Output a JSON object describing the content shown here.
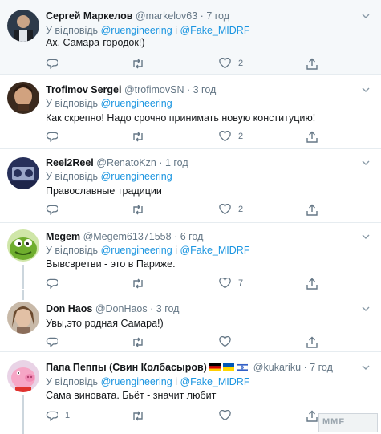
{
  "reply_prefix": "У відповідь",
  "and_word": "і",
  "dot": "·",
  "colors": {
    "link": "#1b95e0",
    "muted": "#657786",
    "text": "#14171a",
    "thread": "#ccd6dd",
    "highlight_bg": "#f5f8fa"
  },
  "tweets": [
    {
      "name": "Сергей Маркелов",
      "handle": "@markelov63",
      "time": "7 год",
      "mentions": [
        "@ruengineering",
        "@Fake_MIDRF"
      ],
      "text": "Ах, Самара-городок!)",
      "reply_count": "",
      "like_count": "2"
    },
    {
      "name": "Trofimov Sergei",
      "handle": "@trofimovSN",
      "time": "3 год",
      "mentions": [
        "@ruengineering"
      ],
      "text": "Как скрепно! Надо срочно принимать новую конституцию!",
      "reply_count": "",
      "like_count": "2"
    },
    {
      "name": "Reel2Reel",
      "handle": "@RenatoKzn",
      "time": "1 год",
      "mentions": [
        "@ruengineering"
      ],
      "text": "Православные традиции",
      "reply_count": "",
      "like_count": "2"
    },
    {
      "name": "Megem",
      "handle": "@Megem61371558",
      "time": "6 год",
      "mentions": [
        "@ruengineering",
        "@Fake_MIDRF"
      ],
      "text": "Вывсвретви - это в Париже.",
      "reply_count": "",
      "like_count": "7"
    },
    {
      "name": "Don Haos",
      "handle": "@DonHaos",
      "time": "3 год",
      "mentions": [],
      "text": "Увы,это родная Самара!)",
      "reply_count": "",
      "like_count": ""
    },
    {
      "name": "Папа Пеппы (Свин Колбасыров)",
      "handle": "@kukariku",
      "time": "7 год",
      "flags": [
        "germany-flag",
        "ukraine-flag",
        "israel-flag"
      ],
      "mentions": [
        "@ruengineering",
        "@Fake_MIDRF"
      ],
      "text": "Сама виновата. Бьёт - значит любит",
      "reply_count": "1",
      "like_count": ""
    }
  ],
  "watermark": "MMF"
}
